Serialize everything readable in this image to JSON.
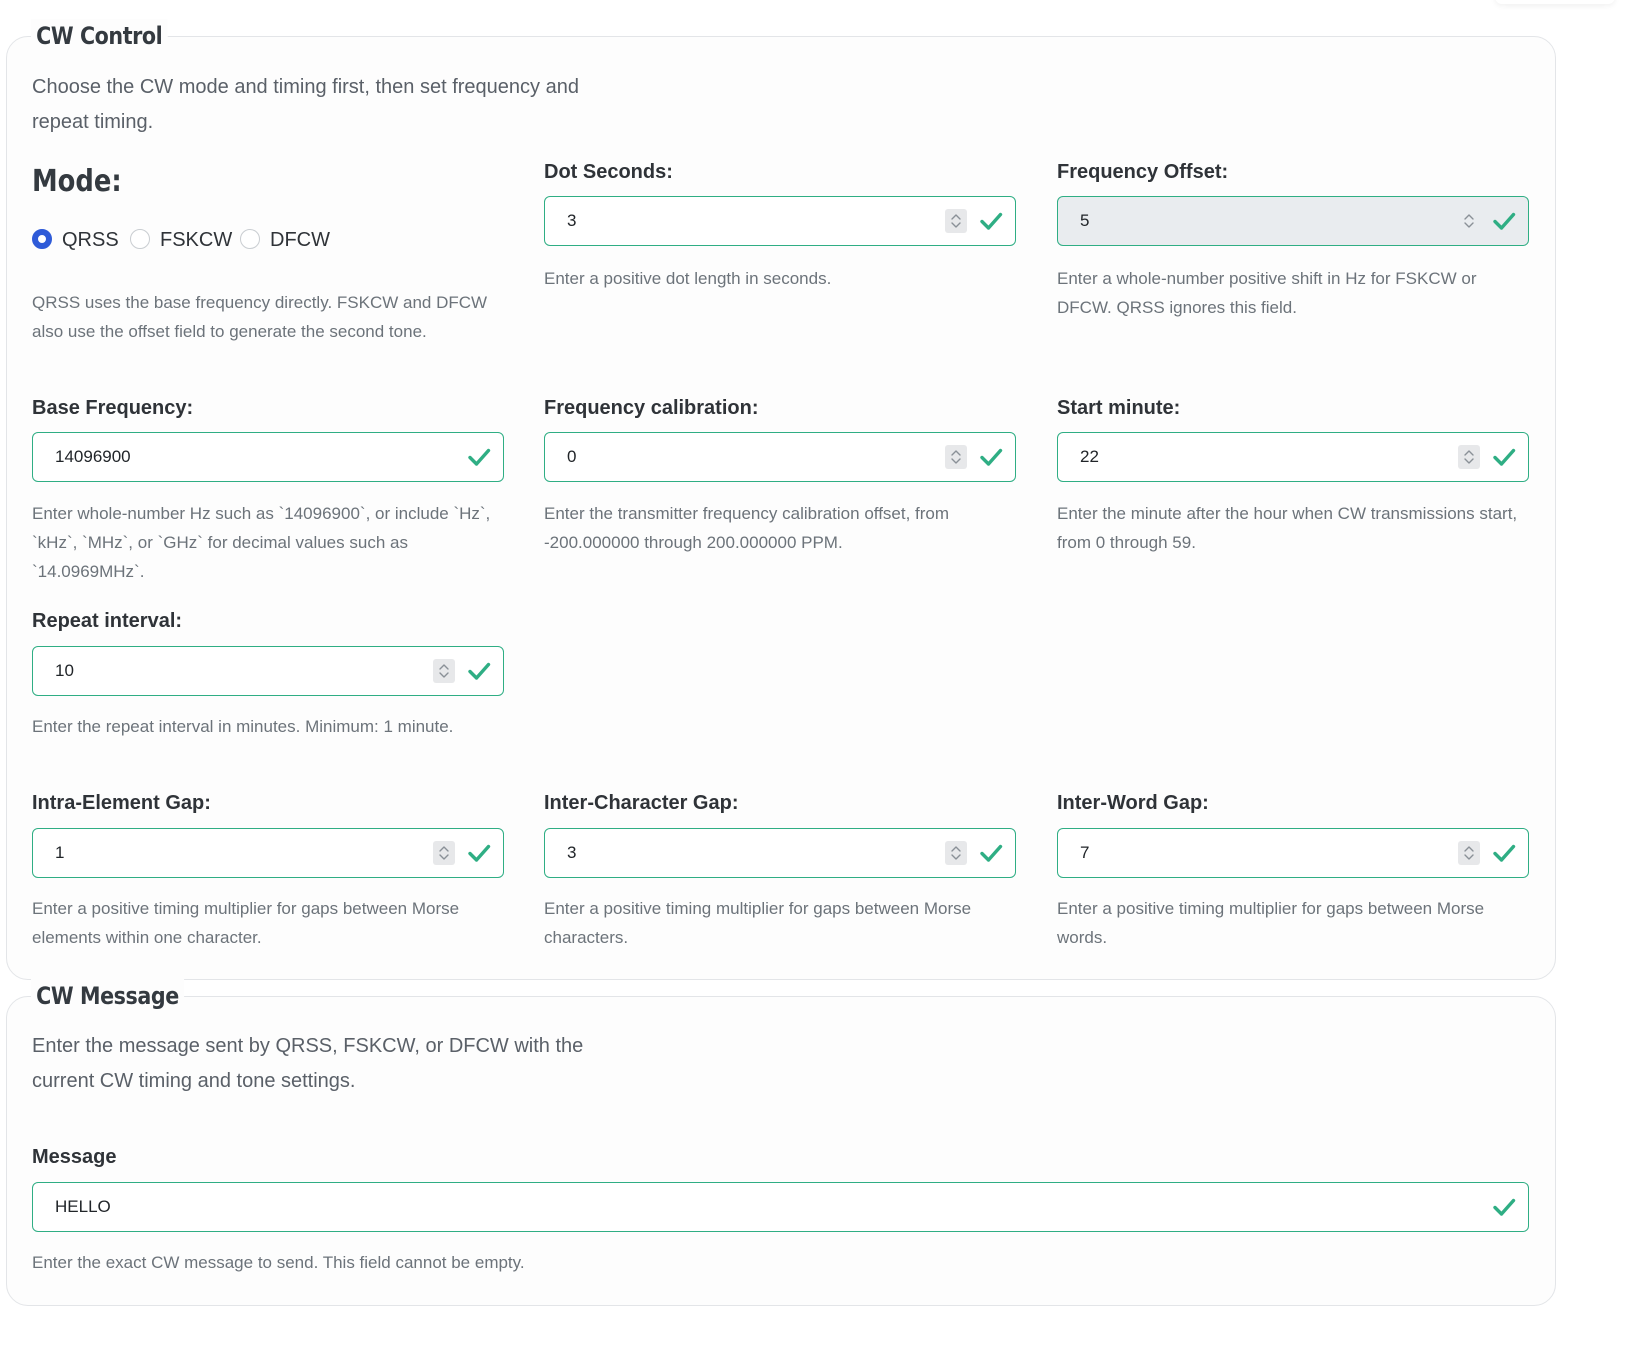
{
  "cw_control": {
    "legend": "CW Control",
    "intro": "Choose the CW mode and timing first, then set frequency and repeat timing.",
    "mode": {
      "title": "Mode:",
      "options": [
        {
          "label": "QRSS",
          "selected": true
        },
        {
          "label": "FSKCW",
          "selected": false
        },
        {
          "label": "DFCW",
          "selected": false
        }
      ],
      "help": "QRSS uses the base frequency directly. FSKCW and DFCW also use the offset field to generate the second tone."
    },
    "dot_seconds": {
      "label": "Dot Seconds:",
      "value": "3",
      "help": "Enter a positive dot length in seconds."
    },
    "frequency_offset": {
      "label": "Frequency Offset:",
      "value": "5",
      "disabled": true,
      "help": "Enter a whole-number positive shift in Hz for FSKCW or DFCW. QRSS ignores this field."
    },
    "base_frequency": {
      "label": "Base Frequency:",
      "value": "14096900",
      "help": "Enter whole-number Hz such as `14096900`, or include `Hz`, `kHz`, `MHz`, or `GHz` for decimal values such as `14.0969MHz`."
    },
    "frequency_calibration": {
      "label": "Frequency calibration:",
      "value": "0",
      "help": "Enter the transmitter frequency calibration offset, from -200.000000 through 200.000000 PPM."
    },
    "start_minute": {
      "label": "Start minute:",
      "value": "22",
      "help": "Enter the minute after the hour when CW transmissions start, from 0 through 59."
    },
    "repeat_interval": {
      "label": "Repeat interval:",
      "value": "10",
      "help": "Enter the repeat interval in minutes. Minimum: 1 minute."
    },
    "intra_element_gap": {
      "label": "Intra-Element Gap:",
      "value": "1",
      "help": "Enter a positive timing multiplier for gaps between Morse elements within one character."
    },
    "inter_character_gap": {
      "label": "Inter-Character Gap:",
      "value": "3",
      "help": "Enter a positive timing multiplier for gaps between Morse characters."
    },
    "inter_word_gap": {
      "label": "Inter-Word Gap:",
      "value": "7",
      "help": "Enter a positive timing multiplier for gaps between Morse words."
    }
  },
  "cw_message": {
    "legend": "CW Message",
    "intro": "Enter the message sent by QRSS, FSKCW, or DFCW with the current CW timing and tone settings.",
    "message": {
      "label": "Message",
      "value": "HELLO",
      "help": "Enter the exact CW message to send. This field cannot be empty."
    }
  },
  "colors": {
    "valid": "#2fae84",
    "radio_selected": "#2f5bd8",
    "disabled_bg": "#e9ecef"
  },
  "icons": {
    "valid": "check-icon",
    "spinner": "spinner-arrows-icon"
  }
}
